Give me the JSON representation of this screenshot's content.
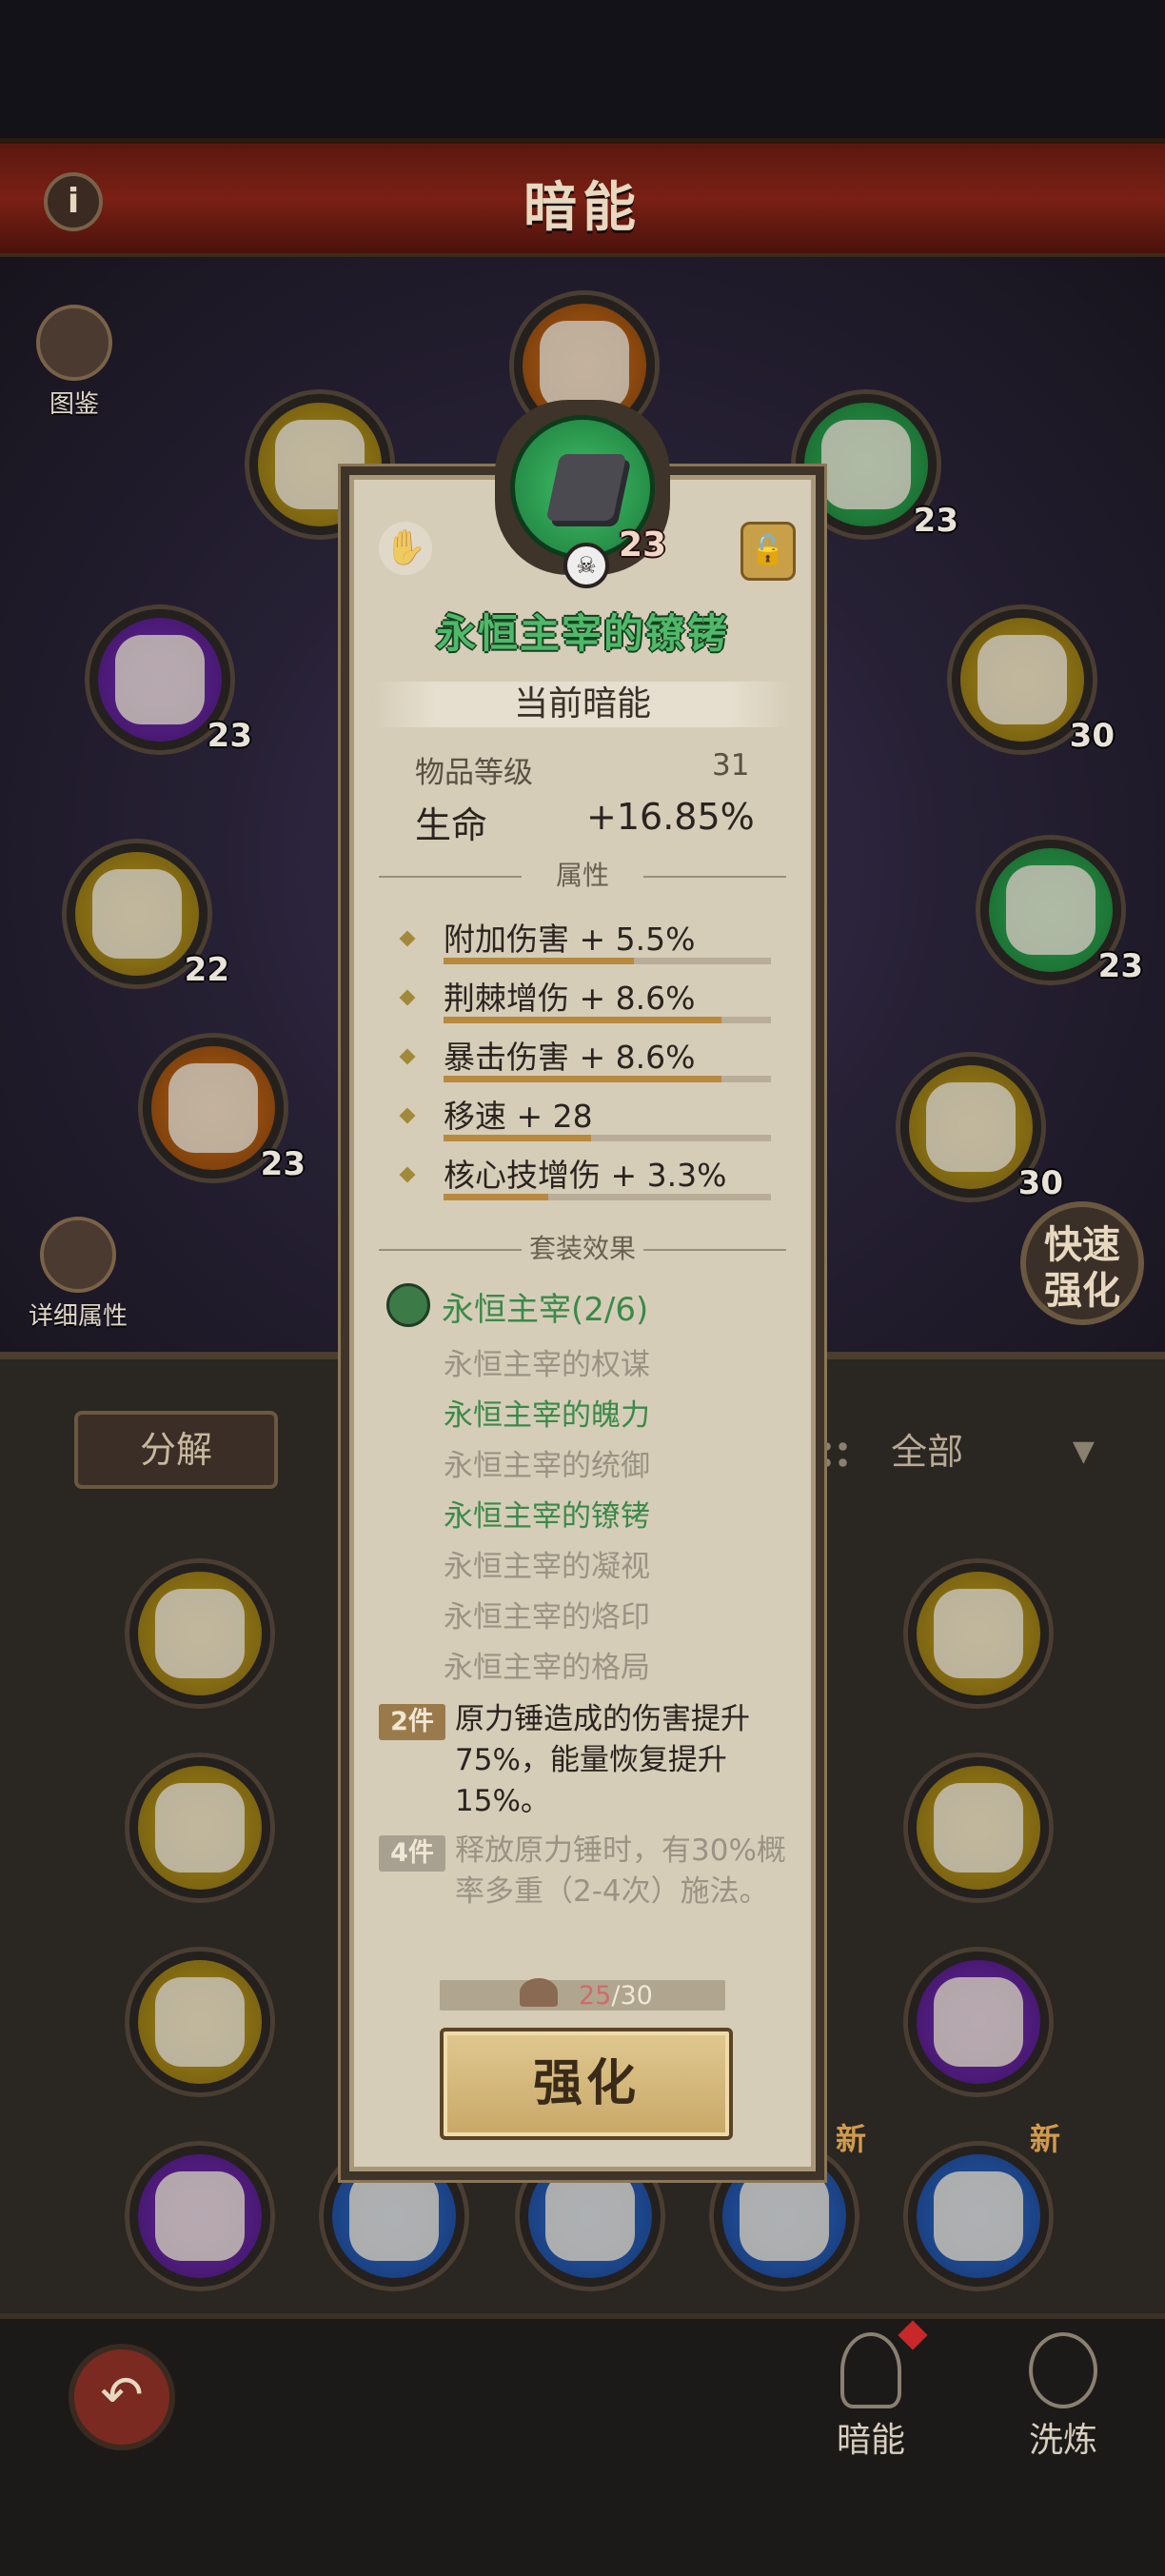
{
  "header": {
    "title": "暗能",
    "info_icon": "info-icon"
  },
  "side": {
    "codex_label": "图鉴",
    "detail_label": "详细属性",
    "quick_enhance": "快速强化"
  },
  "slots": [
    {
      "color": "orange",
      "level": ""
    },
    {
      "color": "yellow",
      "level": ""
    },
    {
      "color": "green",
      "level": "23"
    },
    {
      "color": "purple",
      "level": "23"
    },
    {
      "color": "yellow",
      "level": "30"
    },
    {
      "color": "yellow",
      "level": "22"
    },
    {
      "color": "green",
      "level": "23"
    },
    {
      "color": "orange",
      "level": "23"
    },
    {
      "color": "yellow",
      "level": "30"
    }
  ],
  "inventory": {
    "decompose_label": "分解",
    "filter_label": "全部",
    "new_badge": "新"
  },
  "nav": {
    "back": "back-icon",
    "tab_dark": "暗能",
    "tab_wash": "洗炼"
  },
  "item": {
    "name": "永恒主宰的镣铐",
    "level": "23",
    "current_label": "当前暗能",
    "item_level_label": "物品等级",
    "item_level": "31",
    "main_stat_label": "生命",
    "main_stat_value": "+16.85%",
    "attributes_header": "属性",
    "attributes": [
      {
        "text": "附加伤害 + 5.5%",
        "fill": 0.58
      },
      {
        "text": "荆棘增伤 + 8.6%",
        "fill": 0.85
      },
      {
        "text": "暴击伤害 + 8.6%",
        "fill": 0.85
      },
      {
        "text": "移速 + 28",
        "fill": 0.45
      },
      {
        "text": "核心技增伤 + 3.3%",
        "fill": 0.32
      }
    ],
    "set_header": "套装效果",
    "set_name": "永恒主宰(2/6)",
    "set_pieces": [
      {
        "name": "永恒主宰的权谋",
        "owned": false
      },
      {
        "name": "永恒主宰的魄力",
        "owned": true
      },
      {
        "name": "永恒主宰的统御",
        "owned": false
      },
      {
        "name": "永恒主宰的镣铐",
        "owned": true
      },
      {
        "name": "永恒主宰的凝视",
        "owned": false
      },
      {
        "name": "永恒主宰的烙印",
        "owned": false
      },
      {
        "name": "永恒主宰的格局",
        "owned": false
      }
    ],
    "bonus2_tag": "2件",
    "bonus2_text": "原力锤造成的伤害提升75%，能量恢复提升15%。",
    "bonus4_tag": "4件",
    "bonus4_text": "释放原力锤时，有30%概率多重（2-4次）施法。",
    "material_current": "25",
    "material_total": "/30",
    "enhance_label": "强化"
  },
  "colors": {
    "set_active": "#3a8a4a",
    "set_inactive": "#9a9284",
    "item_name": "#50b86a",
    "popup_bg": "#d6cdb8"
  }
}
